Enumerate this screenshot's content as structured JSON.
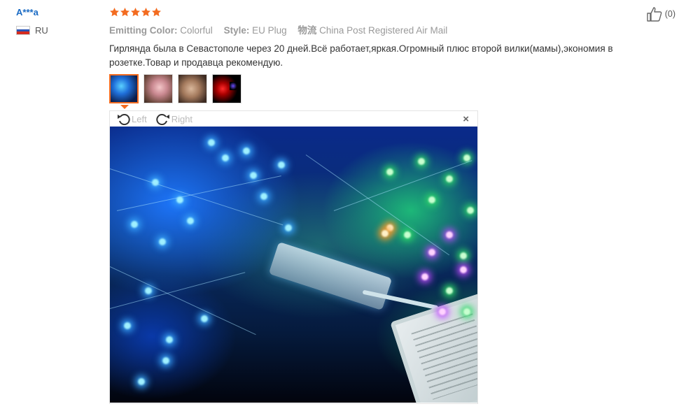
{
  "reviewer": {
    "name": "A***a",
    "country_code": "RU",
    "flag_icon": "russia-flag-icon"
  },
  "review": {
    "rating": 5,
    "rating_max": 5,
    "star_color": "#f36c21",
    "attributes": [
      {
        "key": "Emitting Color:",
        "value": "Colorful"
      },
      {
        "key": "Style:",
        "value": "EU Plug"
      },
      {
        "key": "物流",
        "value": "China Post Registered Air Mail"
      }
    ],
    "text": "Гирлянда была в Севастополе через 20 дней.Всё работает,яркая.Огромный плюс второй вилки(мамы),экономия в розетке.Товар и продавца рекомендую.",
    "photo_count": 4,
    "active_photo": 1
  },
  "viewer": {
    "rotate_left_label": "Left",
    "rotate_right_label": "Right",
    "close_label": "×"
  },
  "helpful": {
    "count_label": "(0)",
    "icon": "thumbs-up-icon"
  },
  "colors": {
    "accent": "#f36c21",
    "link": "#1a6bc4"
  }
}
